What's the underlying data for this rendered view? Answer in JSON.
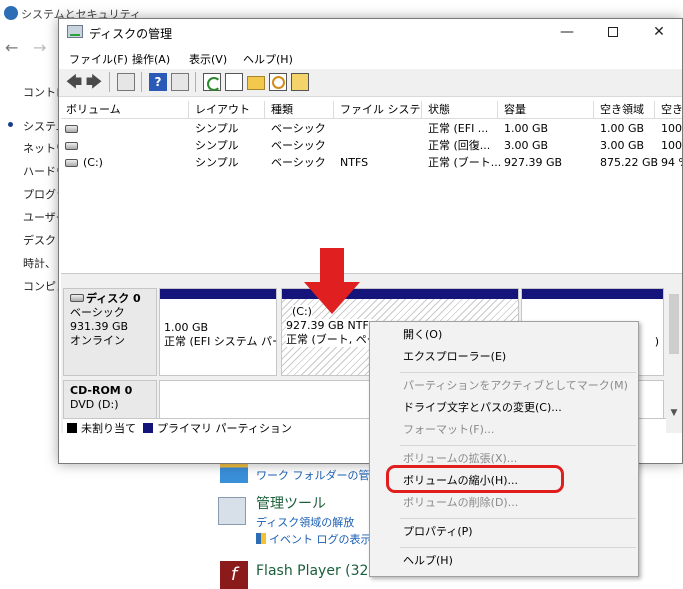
{
  "background_window": {
    "title": "システムとセキュリティ",
    "side_items": [
      "コントロ",
      "システム",
      "ネットワ",
      "ハードウ",
      "プログラ",
      "ユーザー",
      "デスクト",
      "時計、",
      "コンピュ"
    ],
    "work_folders_link": "ワーク フォルダーの管理",
    "admin_tools_heading": "管理ツール",
    "defrag_link": "ディスク領域の解放",
    "event_log_link": "イベント ログの表示",
    "flash_heading": "Flash Player (32"
  },
  "window": {
    "title": "ディスクの管理",
    "minimize": "—",
    "close": "✕"
  },
  "menu": [
    "ファイル(F)",
    "操作(A)",
    "表示(V)",
    "ヘルプ(H)"
  ],
  "toolbar": {
    "back": "🡄",
    "forward": "🡆",
    "help": "?",
    "icons": [
      "back-arrow-icon",
      "forward-arrow-icon",
      "console-tree-icon",
      "help-icon",
      "list-view-icon",
      "refresh-icon",
      "check-disk-icon",
      "open-folder-icon",
      "explore-icon",
      "properties-icon"
    ]
  },
  "volume_table": {
    "columns": [
      "ボリューム",
      "レイアウト",
      "種類",
      "ファイル システム",
      "状態",
      "容量",
      "空き領域",
      "空き"
    ],
    "rows": [
      {
        "volume": "",
        "layout": "シンプル",
        "type": "ベーシック",
        "fs": "",
        "status": "正常 (EFI ...",
        "capacity": "1.00 GB",
        "free": "1.00 GB",
        "pct": "100"
      },
      {
        "volume": "",
        "layout": "シンプル",
        "type": "ベーシック",
        "fs": "",
        "status": "正常 (回復...",
        "capacity": "3.00 GB",
        "free": "3.00 GB",
        "pct": "100"
      },
      {
        "volume": "(C:)",
        "layout": "シンプル",
        "type": "ベーシック",
        "fs": "NTFS",
        "status": "正常 (ブート...",
        "capacity": "927.39 GB",
        "free": "875.22 GB",
        "pct": "94 %"
      }
    ]
  },
  "disk0": {
    "name": "ディスク 0",
    "type": "ベーシック",
    "size": "931.39 GB",
    "status": "オンライン",
    "partitions": [
      {
        "line1": "",
        "line2": "1.00 GB",
        "line3": "正常 (EFI システム パー"
      },
      {
        "line1": "(C:)",
        "line2": "927.39 GB NTFS",
        "line3": "正常 (ブート, ペー"
      },
      {
        "line1": "",
        "line2": "",
        "line3": ")"
      }
    ]
  },
  "cdrom": {
    "name": "CD-ROM 0",
    "type": "DVD (D:)"
  },
  "legend": [
    {
      "label": "未割り当て",
      "color": "#000000"
    },
    {
      "label": "プライマリ パーティション",
      "color": "#14147a"
    }
  ],
  "context_menu": [
    {
      "label": "開く(O)",
      "enabled": true
    },
    {
      "label": "エクスプローラー(E)",
      "enabled": true
    },
    {
      "label": "パーティションをアクティブとしてマーク(M)",
      "enabled": false
    },
    {
      "label": "ドライブ文字とパスの変更(C)...",
      "enabled": true
    },
    {
      "label": "フォーマット(F)...",
      "enabled": false
    },
    {
      "label": "ボリュームの拡張(X)...",
      "enabled": false
    },
    {
      "label": "ボリュームの縮小(H)...",
      "enabled": true
    },
    {
      "label": "ボリュームの削除(D)...",
      "enabled": false
    },
    {
      "label": "プロパティ(P)",
      "enabled": true
    },
    {
      "label": "ヘルプ(H)",
      "enabled": true
    }
  ],
  "accent_colors": {
    "partition_bar": "#14147a",
    "highlight": "#e01e1e",
    "arrow": "#e02020"
  }
}
